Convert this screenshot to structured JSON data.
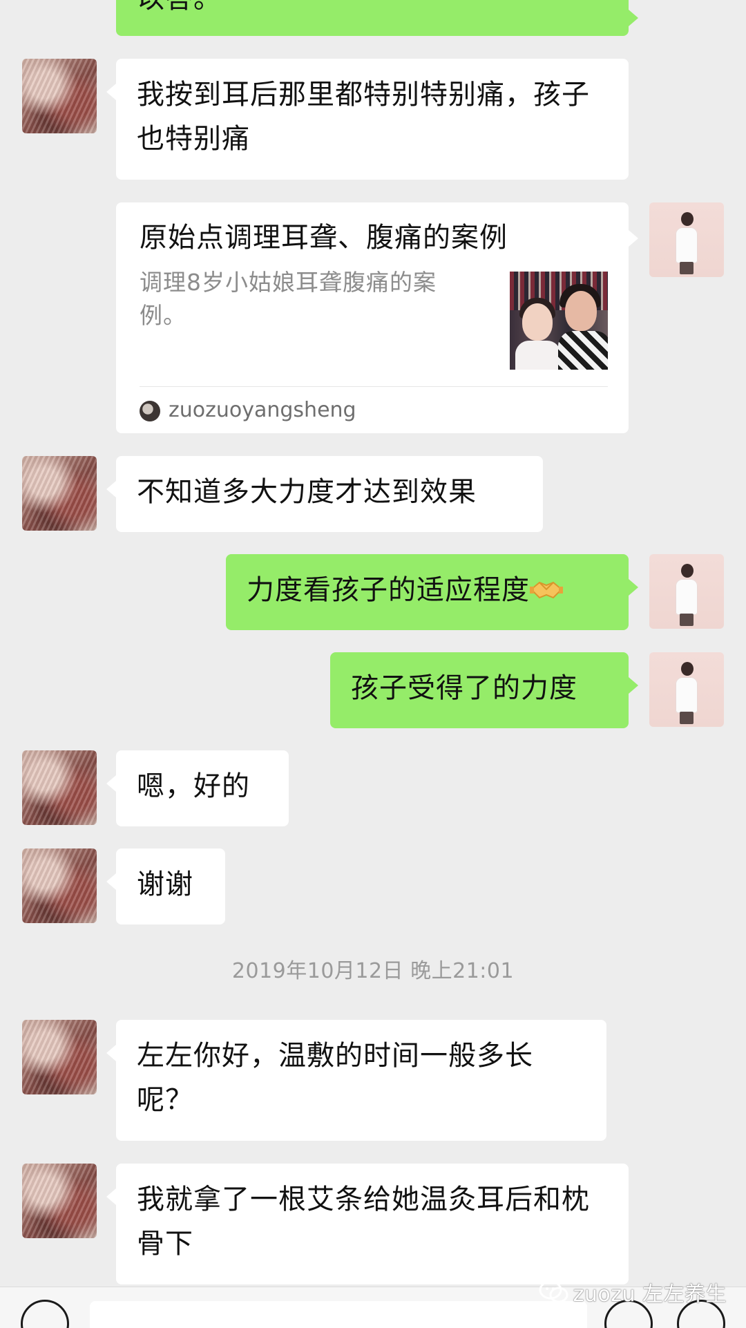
{
  "chat": {
    "messages": [
      {
        "id": "m0",
        "side": "out",
        "text": "以答。"
      },
      {
        "id": "m1",
        "side": "in",
        "text": "我按到耳后那里都特别特别痛，孩子也特别痛"
      },
      {
        "id": "m3",
        "side": "in",
        "text": "不知道多大力度才达到效果"
      },
      {
        "id": "m4",
        "side": "out",
        "text": "力度看孩子的适应程度"
      },
      {
        "id": "m5",
        "side": "out",
        "text": "孩子受得了的力度"
      },
      {
        "id": "m6",
        "side": "in",
        "text": "嗯，好的"
      },
      {
        "id": "m7",
        "side": "in",
        "text": "谢谢"
      },
      {
        "id": "m8",
        "side": "in",
        "text": "左左你好，温敷的时间一般多长呢？"
      },
      {
        "id": "m9",
        "side": "in",
        "text": "我就拿了一根艾条给她温灸耳后和枕骨下"
      }
    ],
    "link_card": {
      "title": "原始点调理耳聋、腹痛的案例",
      "description": "调理8岁小姑娘耳聋腹痛的案例。",
      "source": "zuozuoyangsheng"
    },
    "timestamp": "2019年10月12日 晚上21:01",
    "emoji_icon": "handshake-emoji"
  },
  "watermark": {
    "text": "zuozu 左左养生",
    "icon": "wechat-icon"
  },
  "colors": {
    "background": "#ededed",
    "incoming_bubble": "#ffffff",
    "outgoing_bubble": "#95ec69",
    "timestamp": "#9a9a9a"
  }
}
